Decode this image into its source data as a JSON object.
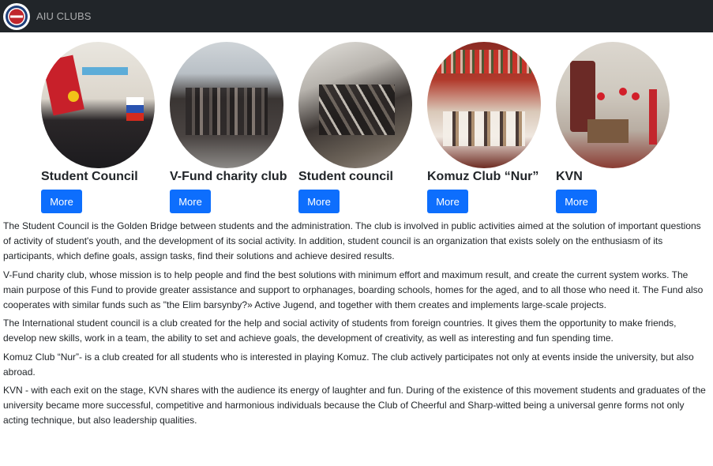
{
  "navbar": {
    "brand": "AIU CLUBS"
  },
  "clubs": [
    {
      "title": "Student Council",
      "button": "More"
    },
    {
      "title": "V-Fund charity club",
      "button": "More"
    },
    {
      "title": "Student council",
      "button": "More"
    },
    {
      "title": "Komuz Club “Nur”",
      "button": "More"
    },
    {
      "title": "KVN",
      "button": "More"
    }
  ],
  "descriptions": [
    "The Student Council is the Golden Bridge between students and the administration. The club is involved in public activities aimed at the solution of important questions of activity of student's youth, and the development of its social activity. In addition, student council is an organization that exists solely on the enthusiasm of its participants, which define goals, assign tasks, find their solutions and achieve desired results.",
    "V-Fund charity club, whose mission is to help people and find the best solutions with minimum effort and maximum result, and create the current system works. The main purpose of this Fund to provide greater assistance and support to orphanages, boarding schools, homes for the aged, and to all those who need it. The Fund also cooperates with similar funds such as \"the Elim barsynby?» Active Jugend, and together with them creates and implements large-scale projects.",
    "The International student council is a club created for the help and social activity of students from foreign countries. It gives them the opportunity to make friends, develop new skills, work in a team, the ability to set and achieve goals, the development of creativity, as well as interesting and fun spending time.",
    "Komuz Club “Nur”- is a club created for all students who is interested in playing Komuz. The club actively participates not only at events inside the university, but also abroad.",
    "KVN - with each exit on the stage, KVN shares with the audience its energy of laughter and fun. During of the existence of this movement students and graduates of the university became more successful, competitive and harmonious individuals because the Club of Cheerful and Sharp-witted being a universal genre forms not only acting technique, but also leadership qualities."
  ]
}
